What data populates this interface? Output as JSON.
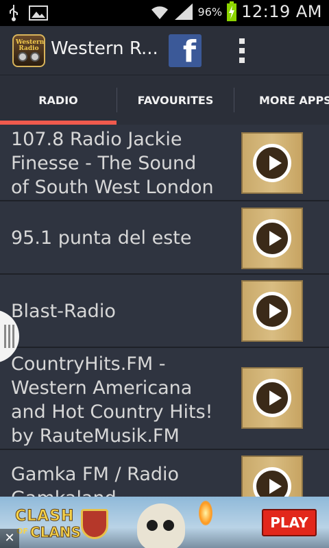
{
  "status_bar": {
    "time": "12:19 AM",
    "battery_percent": "96%",
    "icons": [
      "usb-icon",
      "image-icon",
      "wifi-icon",
      "signal-icon",
      "battery-charging-icon"
    ]
  },
  "action_bar": {
    "title": "Western R...",
    "app_icon_text": "Western Radio",
    "facebook_label": "f",
    "overflow_icon": "overflow-menu-icon"
  },
  "tabs": [
    {
      "label": "RADIO",
      "selected": true
    },
    {
      "label": "FAVOURITES",
      "selected": false
    },
    {
      "label": "MORE APPS",
      "selected": false
    }
  ],
  "stations": [
    {
      "name": "107.8 Radio Jackie Finesse - The Sound of South West London"
    },
    {
      "name": "95.1 punta del este"
    },
    {
      "name": "Blast-Radio"
    },
    {
      "name": "CountryHits.FM - Western Americana and Hot Country Hits! by RauteMusik.FM"
    },
    {
      "name": "Gamka FM / Radio Gamkaland"
    }
  ],
  "ad": {
    "logo_line1": "CLASH",
    "logo_line2": "CLANS",
    "logo_of": "OF",
    "cta": "PLAY",
    "close": "✕"
  },
  "colors": {
    "accent": "#f05a4d",
    "background": "#2f3440",
    "play_button": "#d2b477",
    "facebook": "#3b5998"
  }
}
